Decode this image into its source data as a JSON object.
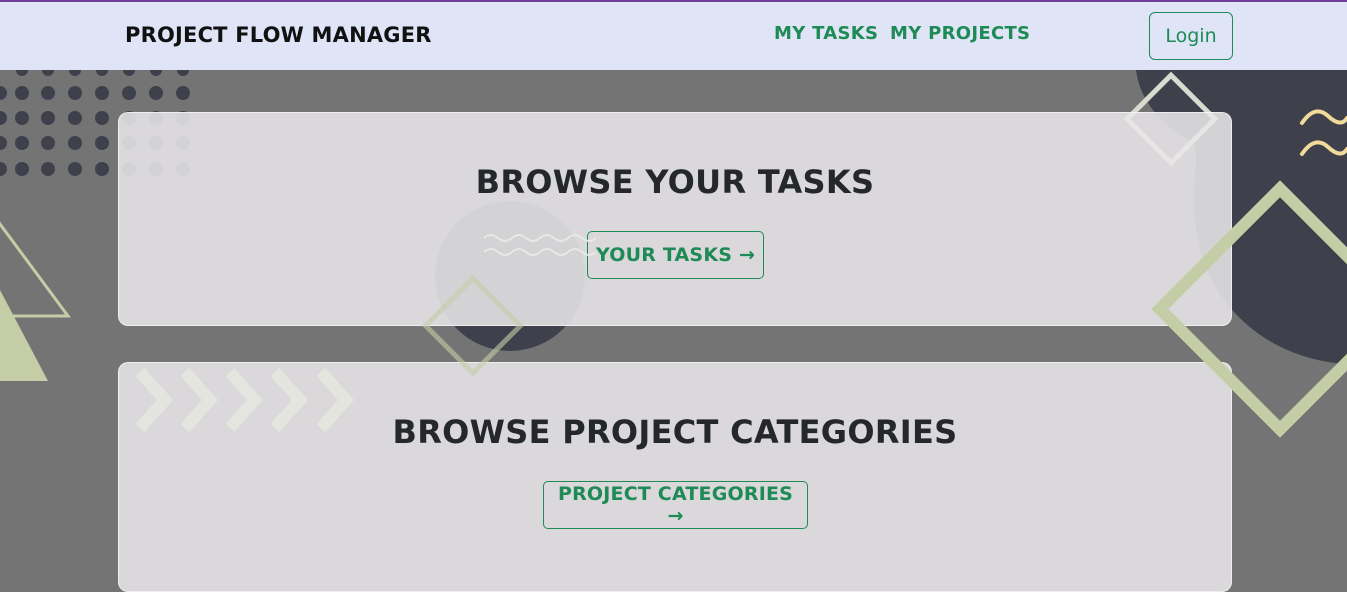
{
  "navbar": {
    "brand": "PROJECT FLOW MANAGER",
    "links": [
      {
        "label": "MY TASKS"
      },
      {
        "label": "MY PROJECTS"
      }
    ],
    "login_label": "Login"
  },
  "cards": [
    {
      "title": "BROWSE YOUR TASKS",
      "button_label": "YOUR TASKS →"
    },
    {
      "title": "BROWSE PROJECT CATEGORIES",
      "button_label": "PROJECT CATEGORIES →"
    }
  ],
  "colors": {
    "accent": "#1e8a55",
    "navbar_bg": "#dfe5f6",
    "page_bg": "#747474",
    "dark_shape": "#3e414c",
    "sage_shape": "#c4cda6",
    "yellow_wave": "#f1da9a"
  },
  "icons": [
    "arrow-right-icon"
  ]
}
